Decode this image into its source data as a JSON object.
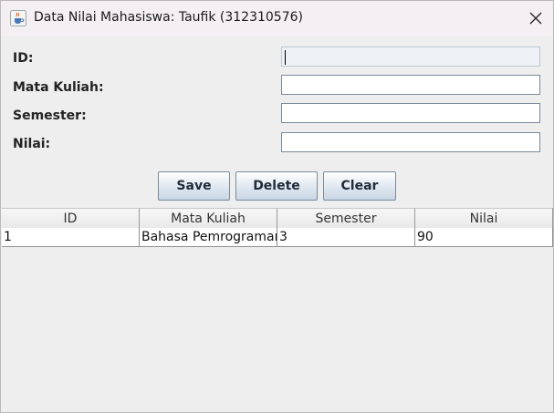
{
  "window": {
    "title": "Data Nilai Mahasiswa: Taufik (312310576)"
  },
  "form": {
    "fields": [
      {
        "label": "ID:",
        "value": ""
      },
      {
        "label": "Mata Kuliah:",
        "value": ""
      },
      {
        "label": "Semester:",
        "value": ""
      },
      {
        "label": "Nilai:",
        "value": ""
      }
    ]
  },
  "buttons": {
    "save": "Save",
    "delete": "Delete",
    "clear": "Clear"
  },
  "table": {
    "columns": [
      "ID",
      "Mata Kuliah",
      "Semester",
      "Nilai"
    ],
    "rows": [
      [
        "1",
        "Bahasa Pemrograman",
        "3",
        "90"
      ]
    ]
  },
  "icons": {
    "app": "java-cup-icon",
    "close": "close-icon"
  }
}
